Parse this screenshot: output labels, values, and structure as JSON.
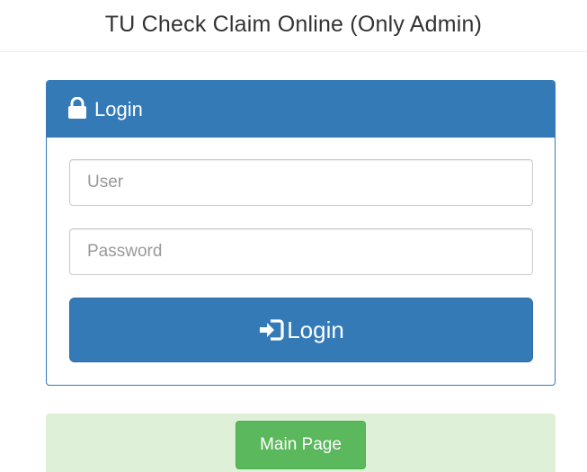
{
  "header": {
    "title": "TU Check Claim Online (Only Admin)"
  },
  "login_panel": {
    "title": "Login",
    "title_icon": "lock-icon",
    "user_field": {
      "value": "",
      "placeholder": "User"
    },
    "password_field": {
      "value": "",
      "placeholder": "Password"
    },
    "submit_label": "Login",
    "submit_icon": "log-in-icon"
  },
  "footer_alert": {
    "main_page_label": "Main Page"
  },
  "colors": {
    "primary": "#337ab7",
    "success_bg": "#dff0d8",
    "success_button": "#5cb85c"
  }
}
